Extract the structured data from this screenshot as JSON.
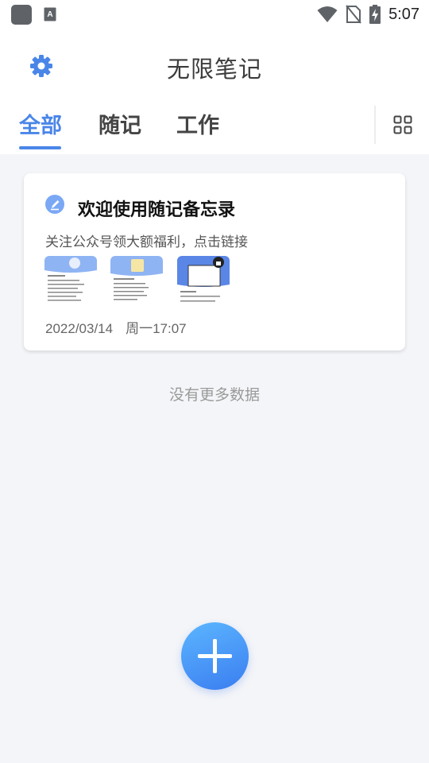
{
  "status_bar": {
    "time": "5:07",
    "icons": [
      "app-icon",
      "keyboard-a-icon",
      "wifi-icon",
      "no-sim-icon",
      "battery-charging-icon"
    ]
  },
  "header": {
    "title": "无限笔记",
    "settings_icon": "gear-icon",
    "layout_icon": "grid-icon"
  },
  "tabs": [
    {
      "label": "全部",
      "active": true
    },
    {
      "label": "随记",
      "active": false
    },
    {
      "label": "工作",
      "active": false
    }
  ],
  "notes": [
    {
      "icon": "pen-circle-icon",
      "title": "欢迎使用随记备忘录",
      "subtitle": "关注公众号领大额福利，点击链接",
      "thumbnails": [
        "thumbnail-1",
        "thumbnail-2",
        "thumbnail-3-locked"
      ],
      "date": "2022/03/14",
      "weekday_time": "周一17:07"
    }
  ],
  "empty_hint": "没有更多数据",
  "fab": {
    "icon": "plus-icon"
  },
  "colors": {
    "accent": "#4a86e8",
    "background": "#f4f5f8",
    "fab_start": "#5cb6ff",
    "fab_end": "#3a7df0"
  }
}
